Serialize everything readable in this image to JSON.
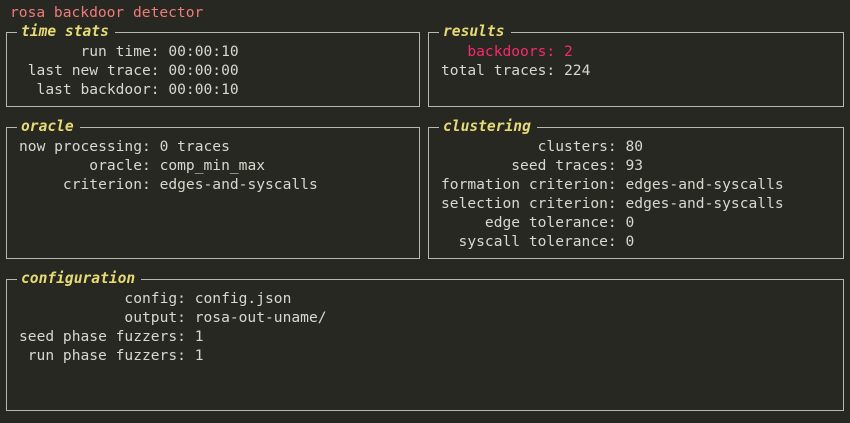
{
  "app_title": "rosa backdoor detector",
  "time_stats": {
    "title": "time stats",
    "rows": [
      {
        "label": "run time",
        "value": "00:00:10"
      },
      {
        "label": "last new trace",
        "value": "00:00:00"
      },
      {
        "label": "last backdoor",
        "value": "00:00:10"
      }
    ]
  },
  "results": {
    "title": "results",
    "rows": [
      {
        "label": "backdoors",
        "value": "2"
      },
      {
        "label": "total traces",
        "value": "224"
      }
    ]
  },
  "oracle": {
    "title": "oracle",
    "rows": [
      {
        "label": "now processing",
        "value": "0 traces"
      },
      {
        "label": "oracle",
        "value": "comp_min_max"
      },
      {
        "label": "criterion",
        "value": "edges-and-syscalls"
      }
    ]
  },
  "clustering": {
    "title": "clustering",
    "rows": [
      {
        "label": "clusters",
        "value": "80"
      },
      {
        "label": "seed traces",
        "value": "93"
      },
      {
        "label": "formation criterion",
        "value": "edges-and-syscalls"
      },
      {
        "label": "selection criterion",
        "value": "edges-and-syscalls"
      },
      {
        "label": "edge tolerance",
        "value": "0"
      },
      {
        "label": "syscall tolerance",
        "value": "0"
      }
    ]
  },
  "configuration": {
    "title": "configuration",
    "rows": [
      {
        "label": "config",
        "value": "config.json"
      },
      {
        "label": "output",
        "value": "rosa-out-uname/"
      },
      {
        "label": "seed phase fuzzers",
        "value": "1"
      },
      {
        "label": "run phase fuzzers",
        "value": "1"
      }
    ]
  },
  "colors": {
    "background": "#272822",
    "title_red": "#f07a7a",
    "section_yellow": "#e6db74",
    "alert_magenta": "#f92672",
    "text": "#d8d8cf"
  }
}
